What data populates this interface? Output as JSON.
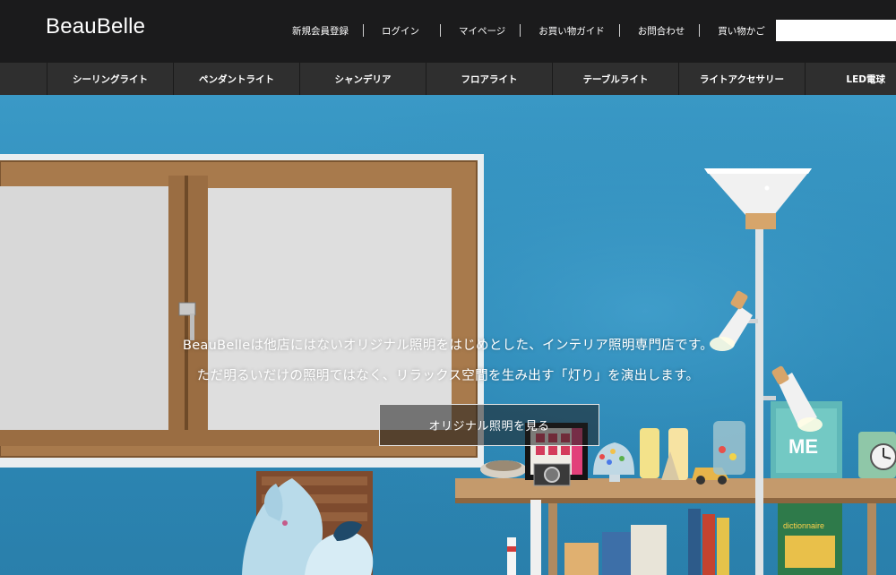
{
  "header": {
    "logo": "BeauBelle",
    "links": [
      {
        "id": "register",
        "label": "新規会員登録"
      },
      {
        "id": "login",
        "label": "ログイン"
      },
      {
        "id": "mypage",
        "label": "マイページ"
      },
      {
        "id": "guide",
        "label": "お買い物ガイド"
      },
      {
        "id": "contact",
        "label": "お問合わせ"
      },
      {
        "id": "cart",
        "label": "買い物かご"
      }
    ],
    "search": {
      "value": "",
      "placeholder": ""
    }
  },
  "categories": [
    {
      "label": "シーリングライト"
    },
    {
      "label": "ペンダントライト"
    },
    {
      "label": "シャンデリア"
    },
    {
      "label": "フロアライト"
    },
    {
      "label": "テーブルライト"
    },
    {
      "label": "ライトアクセサリー"
    },
    {
      "label": "LED電球"
    }
  ],
  "hero": {
    "line1": "BeauBelleは他店にはないオリジナル照明をはじめとした、インテリア照明専門店です。",
    "line2": "ただ明るいだけの照明ではなく、リラックス空間を生み出す「灯り」を演出します。",
    "cta": "オリジナル照明を見る",
    "book_title": "dictionnaire",
    "poster_text": "ME"
  },
  "colors": {
    "header_bg": "#1b1b1c",
    "nav_bg": "#2f2f2f",
    "wall_blue": "#2f8fbc",
    "wood": "#a87a4c"
  }
}
